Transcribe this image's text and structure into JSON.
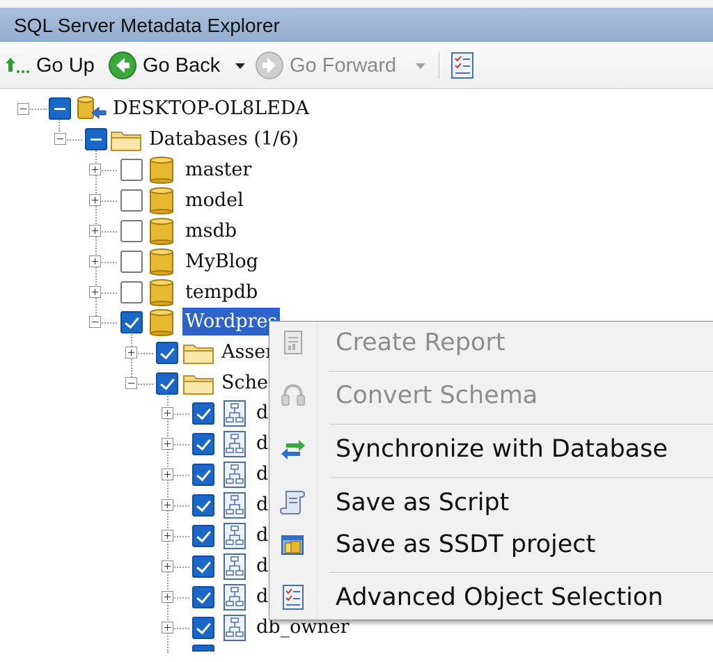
{
  "window": {
    "title": "SQL Server Metadata Explorer"
  },
  "toolbar": {
    "go_up": "Go Up",
    "go_back": "Go Back",
    "go_forward": "Go Forward"
  },
  "tree": {
    "server": "DESKTOP-OL8LEDA",
    "databases": "Databases (1/6)",
    "db_master": "master",
    "db_model": "model",
    "db_msdb": "msdb",
    "db_myblog": "MyBlog",
    "db_tempdb": "tempdb",
    "db_wordpress": "Wordpres",
    "assemblies": "Asser",
    "schemas": "Scher",
    "schema_owner": "db_owner",
    "schema_prefix": "d"
  },
  "context_menu": {
    "create_report": "Create Report",
    "convert_schema": "Convert Schema",
    "synchronize": "Synchronize with Database",
    "save_script": "Save as Script",
    "save_ssdt": "Save as SSDT project",
    "advanced_selection": "Advanced Object Selection"
  },
  "colors": {
    "titlebar": "#9bb4d4",
    "checkbox_blue": "#1a67c8",
    "selection": "#2e63c8",
    "menu_bg": "#f1f1f1"
  }
}
